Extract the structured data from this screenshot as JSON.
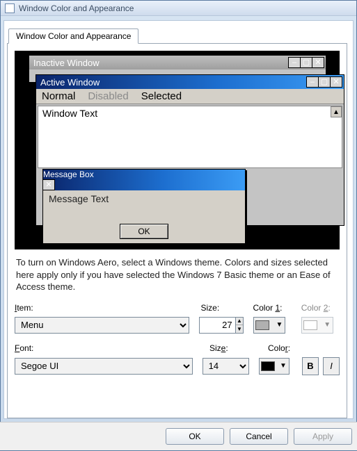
{
  "window": {
    "title": "Window Color and Appearance"
  },
  "tab": {
    "label": "Window Color and Appearance"
  },
  "preview": {
    "inactive_title": "Inactive Window",
    "active_title": "Active Window",
    "menu": {
      "normal": "Normal",
      "disabled": "Disabled",
      "selected": "Selected"
    },
    "window_text": "Window Text",
    "message_box": {
      "title": "Message Box",
      "text": "Message Text",
      "ok": "OK"
    }
  },
  "description": "To turn on Windows Aero, select a Windows theme.  Colors and sizes selected here apply only if you have selected the Windows 7 Basic theme or an Ease of Access theme.",
  "labels": {
    "item": "Item:",
    "size": "Size:",
    "color1_prefix": "Color ",
    "color1_key": "1",
    "color1_suffix": ":",
    "color2_prefix": "Color ",
    "color2_key": "2",
    "color2_suffix": ":",
    "font": "Font:",
    "size2": "Size:",
    "color": "Color:"
  },
  "values": {
    "item": "Menu",
    "item_size": "27",
    "color1": "#B0B0B0",
    "font": "Segoe UI",
    "font_size": "14",
    "font_color": "#000000",
    "bold": "B",
    "italic": "I"
  },
  "buttons": {
    "ok": "OK",
    "cancel": "Cancel",
    "apply": "Apply"
  }
}
